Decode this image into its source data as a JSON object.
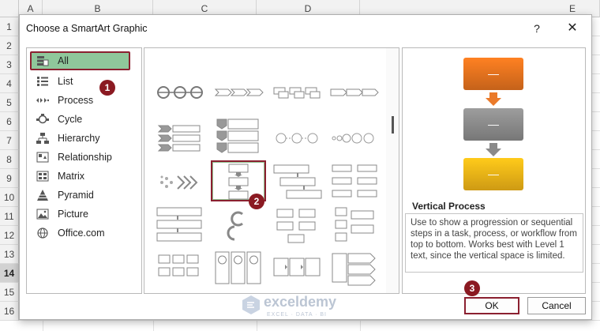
{
  "sheet": {
    "columns": [
      "A",
      "B",
      "C",
      "D",
      "E"
    ],
    "rows": [
      "1",
      "2",
      "3",
      "4",
      "5",
      "6",
      "7",
      "8",
      "9",
      "10",
      "11",
      "12",
      "13",
      "14",
      "15",
      "16"
    ],
    "selected_row": "14"
  },
  "dialog": {
    "title": "Choose a SmartArt Graphic",
    "help_label": "?",
    "close_label": "✕"
  },
  "categories": [
    {
      "label": "All",
      "icon": "all-icon",
      "selected": true
    },
    {
      "label": "List",
      "icon": "list-icon"
    },
    {
      "label": "Process",
      "icon": "process-icon"
    },
    {
      "label": "Cycle",
      "icon": "cycle-icon"
    },
    {
      "label": "Hierarchy",
      "icon": "hierarchy-icon"
    },
    {
      "label": "Relationship",
      "icon": "relationship-icon"
    },
    {
      "label": "Matrix",
      "icon": "matrix-icon"
    },
    {
      "label": "Pyramid",
      "icon": "pyramid-icon"
    },
    {
      "label": "Picture",
      "icon": "picture-icon"
    },
    {
      "label": "Office.com",
      "icon": "globe-icon"
    }
  ],
  "gallery": {
    "selected": "Vertical Process"
  },
  "preview": {
    "title": "Vertical Process",
    "description": "Use to show a progression or sequential steps in a task, process, or workflow from top to bottom. Works best with Level 1 text, since the vertical space is limited.",
    "colors": {
      "box1": "#e8731e",
      "box2": "#8c8c8c",
      "box3": "#f2b517",
      "arrow1": "#ea7a2a",
      "arrow2": "#8a8a8a"
    }
  },
  "buttons": {
    "ok_label": "OK",
    "cancel_label": "Cancel"
  },
  "badges": [
    "1",
    "2",
    "3"
  ],
  "watermark": {
    "name": "exceldemy",
    "tagline": "EXCEL · DATA · BI"
  },
  "accent_color": "#8b2030"
}
